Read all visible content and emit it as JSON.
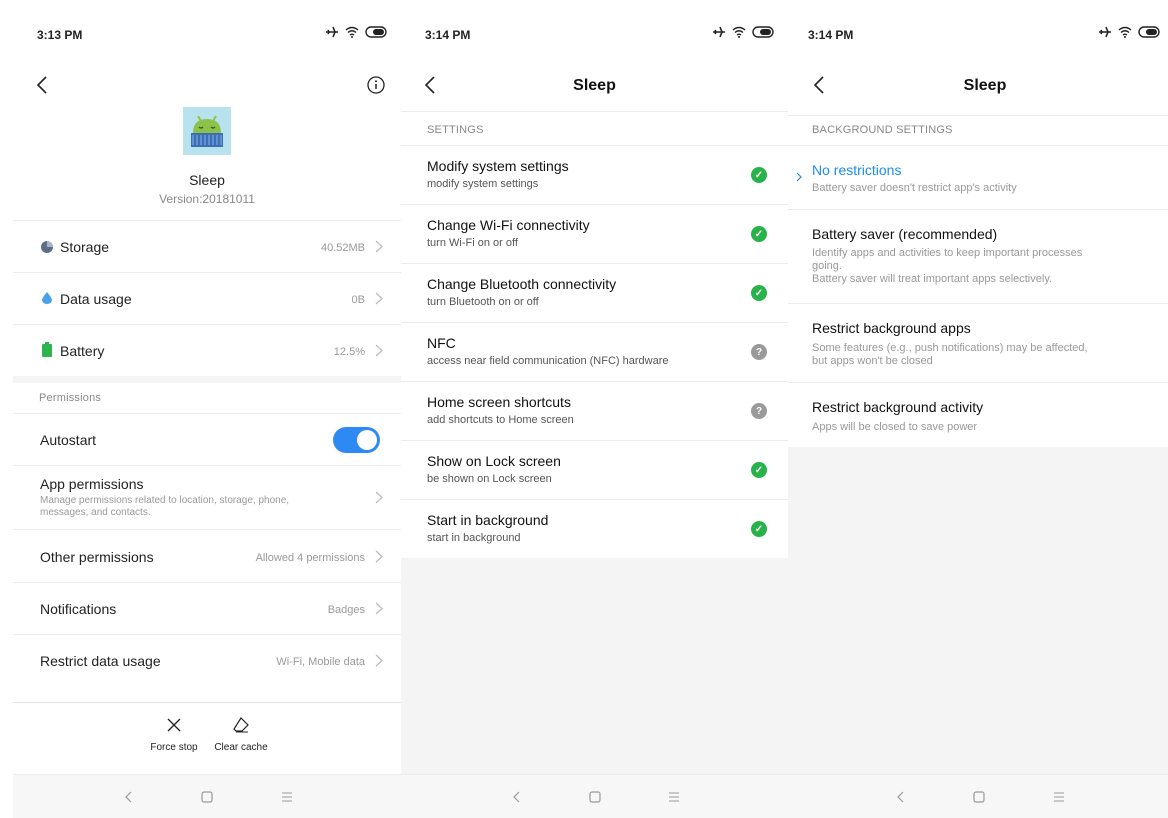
{
  "screen1": {
    "status": {
      "time": "3:13 PM"
    },
    "app_name": "Sleep",
    "app_version": "Version:20181011",
    "rows": [
      {
        "label": "Storage",
        "value": "40.52MB",
        "icon": "pie-chart-icon"
      },
      {
        "label": "Data usage",
        "value": "0B",
        "icon": "water-drop-icon"
      },
      {
        "label": "Battery",
        "value": "12.5%",
        "icon": "battery-icon"
      }
    ],
    "permissions_header": "Permissions",
    "autostart": {
      "label": "Autostart",
      "enabled": true
    },
    "app_permissions": {
      "label": "App permissions",
      "description": "Manage permissions related to location, storage, phone, messages, and contacts."
    },
    "other_permissions": {
      "label": "Other permissions",
      "value": "Allowed 4 permissions"
    },
    "notifications": {
      "label": "Notifications",
      "value": "Badges"
    },
    "restrict_data": {
      "label": "Restrict data usage",
      "value": "Wi-Fi, Mobile data"
    },
    "actions": {
      "force_stop": "Force stop",
      "clear_cache": "Clear cache"
    }
  },
  "screen2": {
    "status": {
      "time": "3:14 PM"
    },
    "title": "Sleep",
    "section": "SETTINGS",
    "items": [
      {
        "title": "Modify system settings",
        "subtitle": "modify system settings",
        "state": "allowed"
      },
      {
        "title": "Change Wi-Fi connectivity",
        "subtitle": "turn Wi-Fi on or off",
        "state": "allowed"
      },
      {
        "title": "Change Bluetooth connectivity",
        "subtitle": "turn Bluetooth on or off",
        "state": "allowed"
      },
      {
        "title": "NFC",
        "subtitle": "access near field communication (NFC) hardware",
        "state": "ask"
      },
      {
        "title": "Home screen shortcuts",
        "subtitle": "add shortcuts to Home screen",
        "state": "ask"
      },
      {
        "title": "Show on Lock screen",
        "subtitle": "be shown on Lock screen",
        "state": "allowed"
      },
      {
        "title": "Start in background",
        "subtitle": "start in background",
        "state": "allowed"
      }
    ]
  },
  "screen3": {
    "status": {
      "time": "3:14 PM"
    },
    "title": "Sleep",
    "section": "BACKGROUND SETTINGS",
    "options": [
      {
        "title": "No restrictions",
        "desc1": "Battery saver doesn't restrict app's activity",
        "desc2": "",
        "desc3": "",
        "selected": true
      },
      {
        "title": "Battery saver (recommended)",
        "desc1": "Identify apps and activities to keep important processes",
        "desc2": "going.",
        "desc3": "Battery saver will treat important apps selectively.",
        "selected": false
      },
      {
        "title": "Restrict background apps",
        "desc1": "Some features (e.g., push notifications) may be affected,",
        "desc2": "but apps won't be closed",
        "desc3": "",
        "selected": false
      },
      {
        "title": "Restrict background activity",
        "desc1": "Apps will be closed to save power",
        "desc2": "",
        "desc3": "",
        "selected": false
      }
    ]
  },
  "colors": {
    "accent": "#1a8ef0",
    "toggle_on": "#2e8af2",
    "allowed": "#27b24a",
    "ask": "#9a9a9a",
    "background_gray": "#f4f4f4"
  }
}
